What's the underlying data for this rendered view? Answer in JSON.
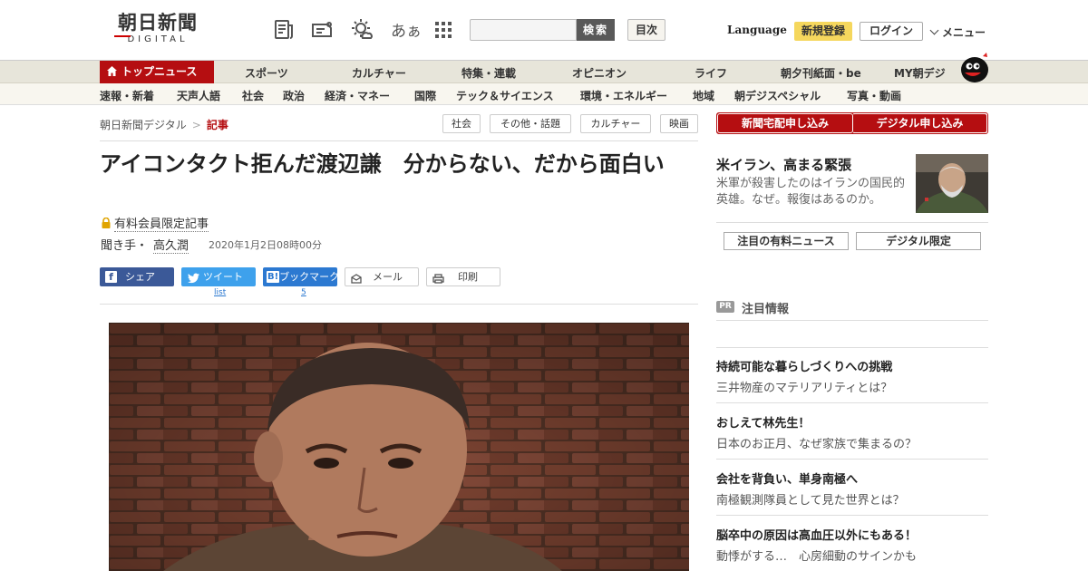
{
  "header": {
    "logo_title": "朝日新聞",
    "logo_sub": "DIGITAL",
    "font_toggle_label": "あぁ",
    "search_placeholder": "",
    "search_button": "検索",
    "toc_button": "目次",
    "language": "Language",
    "signup": "新規登録",
    "login": "ログイン",
    "menu": "メニュー"
  },
  "nav_main": [
    "トップニュース",
    "スポーツ",
    "カルチャー",
    "特集・連載",
    "オピニオン",
    "ライフ",
    "朝夕刊紙面・be",
    "MY朝デジ"
  ],
  "nav_sub": [
    "速報・新着",
    "天声人語",
    "社会",
    "政治",
    "経済・マネー",
    "国際",
    "テック＆サイエンス",
    "環境・エネルギー",
    "地域",
    "朝デジスペシャル",
    "写真・動画"
  ],
  "breadcrumb": {
    "home": "朝日新聞デジタル",
    "sep": ">",
    "current": "記事"
  },
  "tags": [
    "社会",
    "その他・話題",
    "カルチャー",
    "映画"
  ],
  "article": {
    "title": "アイコンタクト拒んだ渡辺謙　分からない、だから面白い",
    "member_label": "有料会員限定記事",
    "interviewer_label": "聞き手・",
    "interviewer_name": "高久潤",
    "date": "2020年1月2日08時00分"
  },
  "share": {
    "facebook": "シェア",
    "twitter": "ツイート",
    "hatena": "ブックマーク",
    "hatena_mark": "B!",
    "mail": "メール",
    "print": "印刷",
    "twitter_count": "list",
    "hatena_count": "5"
  },
  "sidebar": {
    "subscribe_home": "新聞宅配申し込み",
    "subscribe_digital": "デジタル申し込み",
    "feature_title": "米イラン、高まる緊張",
    "feature_desc": "米軍が殺害したのはイランの国民的英雄。なぜ。報復はあるのか。",
    "tab_premium": "注目の有料ニュース",
    "tab_digital": "デジタル限定",
    "pr_badge": "PR",
    "pr_heading": "注目情報",
    "pr_items": [
      {
        "title": "持続可能な暮らしづくりへの挑戦",
        "desc": "三井物産のマテリアリティとは？"
      },
      {
        "title": "おしえて林先生！",
        "desc": "日本のお正月、なぜ家族で集まるの？"
      },
      {
        "title": "会社を背負い、単身南極へ",
        "desc": "南極観測隊員として見た世界とは？"
      },
      {
        "title": "脳卒中の原因は高血圧以外にもある！",
        "desc": "動悸がする…　心房細動のサインかも"
      }
    ]
  },
  "colors": {
    "brand_red": "#b50e11",
    "signup_yellow": "#f5d75d",
    "facebook": "#3b5998",
    "twitter": "#3ea1ec",
    "hatena": "#2c79d1"
  }
}
